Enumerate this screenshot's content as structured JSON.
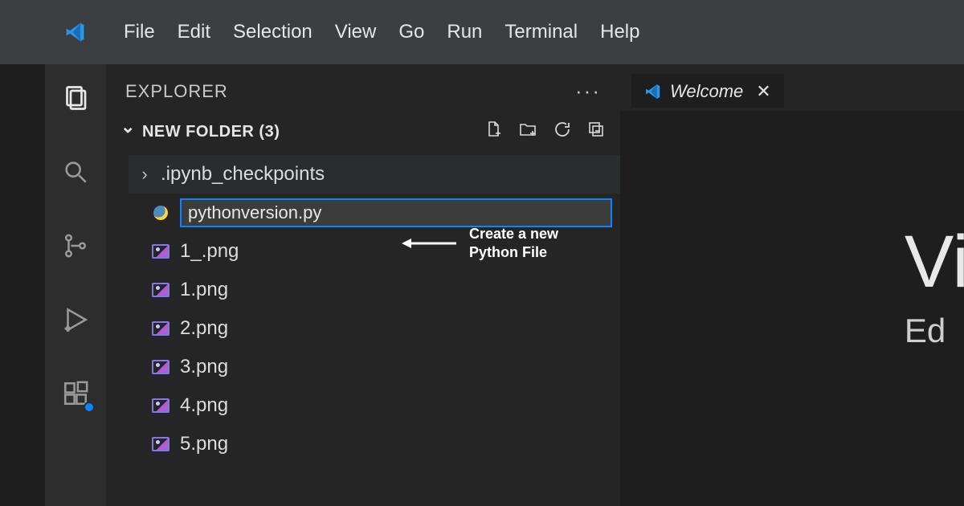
{
  "menu": {
    "file": "File",
    "edit": "Edit",
    "selection": "Selection",
    "view": "View",
    "go": "Go",
    "run": "Run",
    "terminal": "Terminal",
    "help": "Help"
  },
  "explorer": {
    "title": "EXPLORER",
    "folder_label": "NEW FOLDER (3)",
    "tree": [
      {
        "type": "folder",
        "name": ".ipynb_checkpoints"
      },
      {
        "type": "file",
        "name": "pythonversion.py",
        "icon": "python",
        "editing": true
      },
      {
        "type": "file",
        "name": "1_.png",
        "icon": "image"
      },
      {
        "type": "file",
        "name": "1.png",
        "icon": "image"
      },
      {
        "type": "file",
        "name": "2.png",
        "icon": "image"
      },
      {
        "type": "file",
        "name": "3.png",
        "icon": "image"
      },
      {
        "type": "file",
        "name": "4.png",
        "icon": "image"
      },
      {
        "type": "file",
        "name": "5.png",
        "icon": "image"
      }
    ]
  },
  "editor": {
    "tabs": [
      {
        "title": "Welcome"
      }
    ],
    "welcome": {
      "heading_fragment": "Vi",
      "sub_fragment": "Ed"
    }
  },
  "annotation": {
    "line1": "Create a new",
    "line2": "Python File"
  }
}
